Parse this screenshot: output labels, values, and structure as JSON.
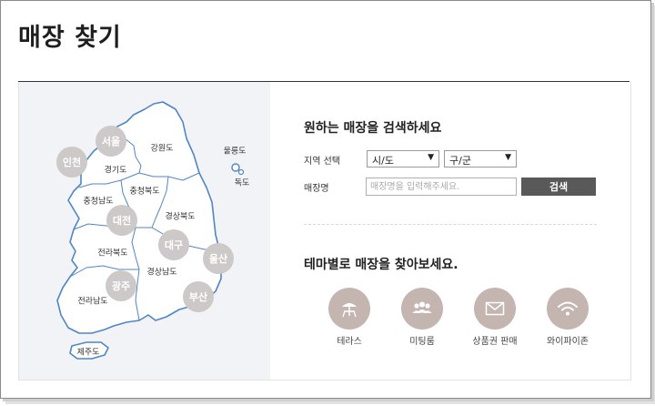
{
  "page": {
    "title": "매장 찾기"
  },
  "map": {
    "regions": [
      {
        "key": "gangwon",
        "label": "강원도"
      },
      {
        "key": "gyeonggi",
        "label": "경기도"
      },
      {
        "key": "chungbuk",
        "label": "충청북도"
      },
      {
        "key": "chungnam",
        "label": "충청남도"
      },
      {
        "key": "gyeongbuk",
        "label": "경상북도"
      },
      {
        "key": "jeonbuk",
        "label": "전라북도"
      },
      {
        "key": "gyeongnam",
        "label": "경상남도"
      },
      {
        "key": "jeonnam",
        "label": "전라남도"
      },
      {
        "key": "jeju",
        "label": "제주도"
      },
      {
        "key": "ulleung",
        "label": "울릉도"
      },
      {
        "key": "dokdo",
        "label": "독도"
      }
    ],
    "cities": [
      {
        "key": "seoul",
        "label": "서울"
      },
      {
        "key": "incheon",
        "label": "인천"
      },
      {
        "key": "daejeon",
        "label": "대전"
      },
      {
        "key": "daegu",
        "label": "대구"
      },
      {
        "key": "ulsan",
        "label": "울산"
      },
      {
        "key": "gwangju",
        "label": "광주"
      },
      {
        "key": "busan",
        "label": "부산"
      }
    ]
  },
  "search": {
    "heading": "원하는 매장을 검색하세요",
    "region_label": "지역 선택",
    "sido_value": "시/도",
    "gugun_value": "구/군",
    "caret": "▼",
    "name_label": "매장명",
    "name_placeholder": "매장명을 입력해주세요.",
    "button_label": "검색"
  },
  "themes": {
    "heading": "테마별로 매장을 찾아보세요.",
    "items": [
      {
        "key": "terrace",
        "label": "테라스",
        "icon": "umbrella-table-icon"
      },
      {
        "key": "meeting",
        "label": "미팅룸",
        "icon": "people-icon"
      },
      {
        "key": "gift",
        "label": "상품권 판매",
        "icon": "envelope-icon"
      },
      {
        "key": "wifi",
        "label": "와이파이존",
        "icon": "wifi-icon"
      }
    ],
    "circle_color": "#c5b5b0"
  },
  "colors": {
    "city_circle": "#cdc9c8",
    "search_button": "#595959",
    "map_bg": "#f1f3f6"
  }
}
